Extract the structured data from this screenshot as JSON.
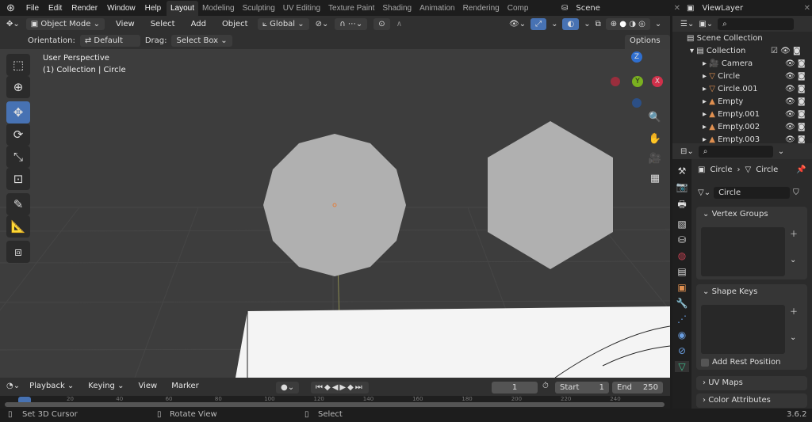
{
  "menu": [
    "File",
    "Edit",
    "Render",
    "Window",
    "Help"
  ],
  "workspaces": [
    "Layout",
    "Modeling",
    "Sculpting",
    "UV Editing",
    "Texture Paint",
    "Shading",
    "Animation",
    "Rendering",
    "Comp"
  ],
  "scene": "Scene",
  "view_layer": "ViewLayer",
  "header": {
    "mode": "Object Mode",
    "items": [
      "View",
      "Select",
      "Add",
      "Object"
    ],
    "transform": "Global",
    "orientation_label": "Orientation:",
    "orientation": "Default",
    "drag_label": "Drag:",
    "drag": "Select Box",
    "options": "Options"
  },
  "viewport": {
    "line1": "User Perspective",
    "line2": "(1) Collection | Circle",
    "gizmo": {
      "z": "Z",
      "y": "Y",
      "x": "X"
    }
  },
  "outliner": {
    "root": "Scene Collection",
    "collection": "Collection",
    "items": [
      "Camera",
      "Circle",
      "Circle.001",
      "Empty",
      "Empty.001",
      "Empty.002",
      "Empty.003"
    ]
  },
  "properties": {
    "breadcrumb_object": "Circle",
    "breadcrumb_data": "Circle",
    "data_name": "Circle",
    "panels": {
      "vertex_groups": "Vertex Groups",
      "shape_keys": "Shape Keys",
      "add_rest": "Add Rest Position",
      "uv_maps": "UV Maps",
      "color_attributes": "Color Attributes"
    }
  },
  "timeline": {
    "menus": [
      "Playback",
      "Keying",
      "View",
      "Marker"
    ],
    "current_frame": "1",
    "start_label": "Start",
    "start": "1",
    "end_label": "End",
    "end": "250",
    "ticks": [
      "20",
      "40",
      "60",
      "80",
      "100",
      "120",
      "140",
      "160",
      "180",
      "200",
      "220",
      "240"
    ]
  },
  "status": {
    "left": "Set 3D Cursor",
    "middle": "Rotate View",
    "right": "Select",
    "version": "3.6.2"
  },
  "colors": {
    "accent": "#4772b3",
    "object_orange": "#e09050",
    "mesh_green": "#3fbf8f"
  }
}
